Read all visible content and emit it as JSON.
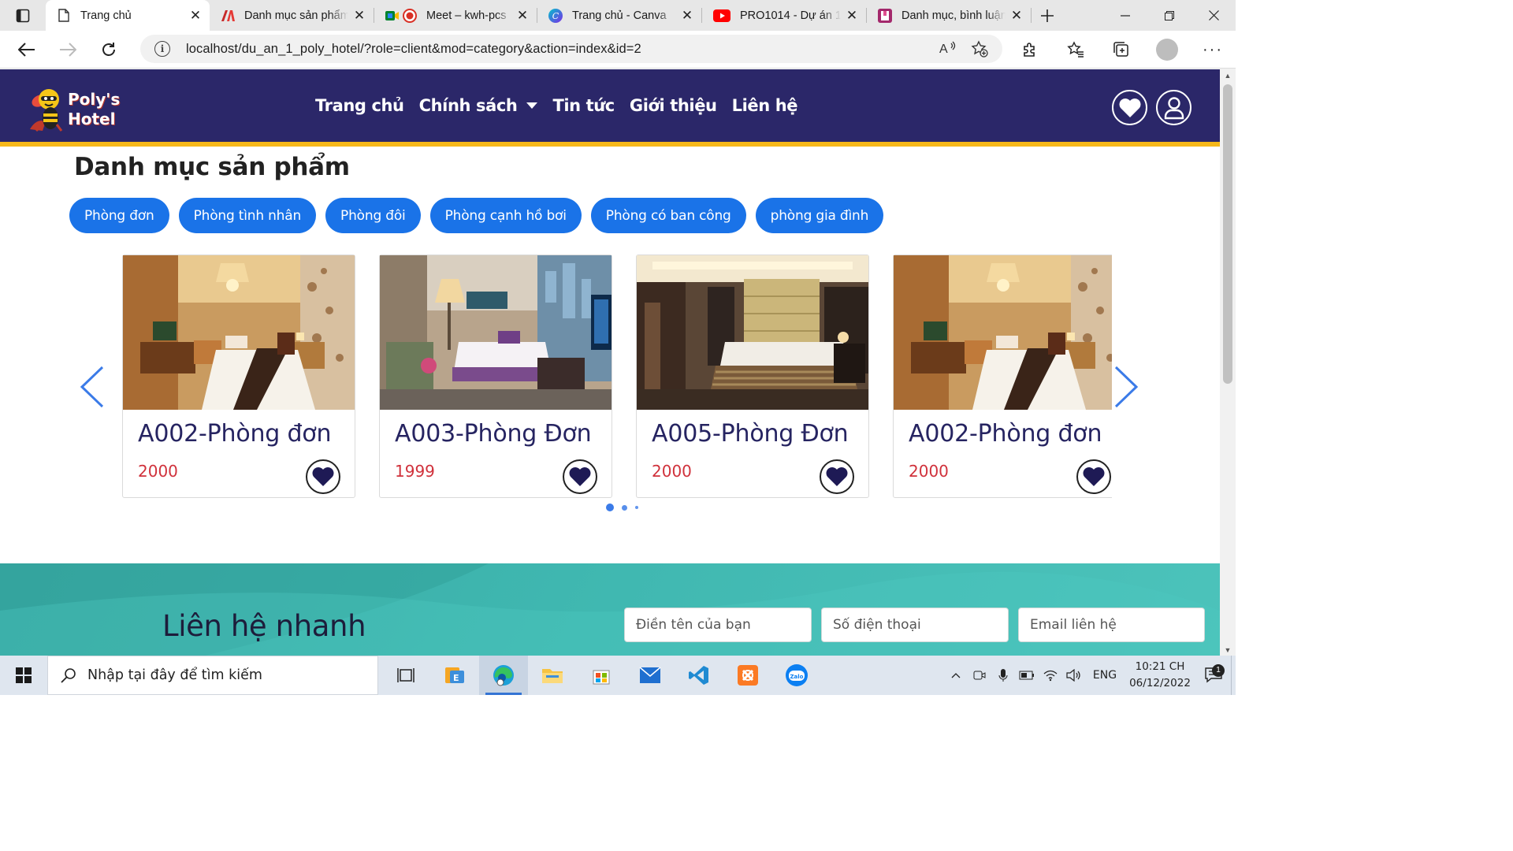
{
  "browser": {
    "tabs": [
      {
        "label": "Trang chủ",
        "icon": "document-icon",
        "active": true
      },
      {
        "label": "Danh mục sản phẩm",
        "icon": "red-a-icon"
      },
      {
        "label": "Meet – kwh-pcs",
        "icon": "meet-icon"
      },
      {
        "label": "Trang chủ - Canva",
        "icon": "canva-icon"
      },
      {
        "label": "PRO1014 - Dự án 1",
        "icon": "youtube-icon"
      },
      {
        "label": "Danh mục, bình luận",
        "icon": "bookmark-icon"
      }
    ],
    "url": "localhost/du_an_1_poly_hotel/?role=client&mod=category&action=index&id=2"
  },
  "site": {
    "logo_line1": "Poly's",
    "logo_line2": "Hotel",
    "nav": [
      {
        "label": "Trang chủ"
      },
      {
        "label": "Chính sách",
        "has_dropdown": true
      },
      {
        "label": "Tin tức"
      },
      {
        "label": "Giới thiệu"
      },
      {
        "label": "Liên hệ"
      }
    ],
    "section_title": "Danh mục sản phẩm",
    "categories": [
      "Phòng đơn",
      "Phòng tình nhân",
      "Phòng đôi",
      "Phòng cạnh hồ bơi",
      "Phòng có ban công",
      "phòng gia đình"
    ],
    "rooms": [
      {
        "name": "A002-Phòng đơn",
        "price": "2000",
        "photo": "warm-bedroom"
      },
      {
        "name": "A003-Phòng Đơn",
        "price": "1999",
        "photo": "modern-bedroom"
      },
      {
        "name": "A005-Phòng Đơn",
        "price": "2000",
        "photo": "luxury-bedroom"
      },
      {
        "name": "A002-Phòng đơn",
        "price": "2000",
        "photo": "warm-bedroom"
      }
    ],
    "carousel_pages": 3,
    "carousel_active": 0,
    "contact": {
      "title": "Liên hệ nhanh",
      "name_placeholder": "Điền tên của bạn",
      "phone_placeholder": "Số điện thoại",
      "email_placeholder": "Email liên hệ"
    },
    "colors": {
      "header_bg": "#2b2769",
      "accent": "#f6b81a",
      "pill": "#1a73e8",
      "price": "#d0313b",
      "contact_bg": "#3fb7b0"
    }
  },
  "taskbar": {
    "search_placeholder": "Nhập tại đây để tìm kiếm",
    "language": "ENG",
    "time": "10:21 CH",
    "date": "06/12/2022",
    "notifications": "1"
  }
}
